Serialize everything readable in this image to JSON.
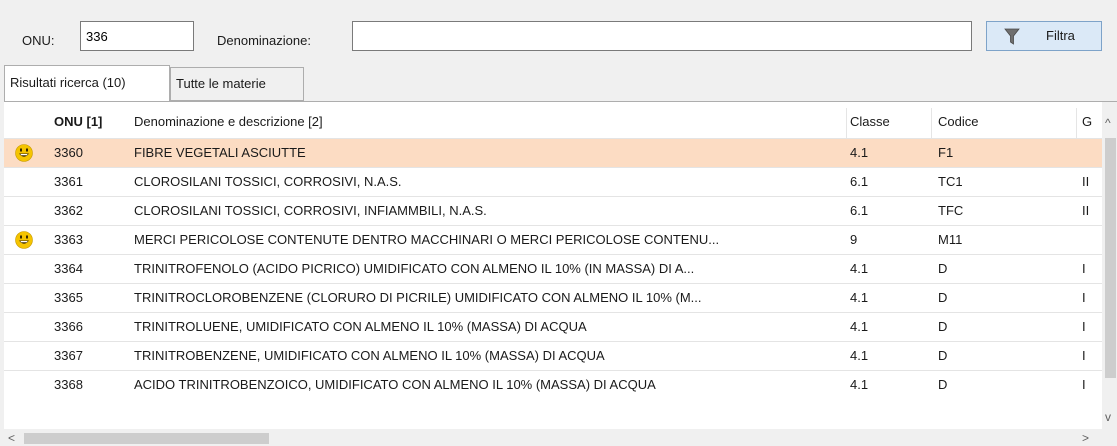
{
  "search": {
    "onu_label": "ONU:",
    "onu_value": "336",
    "denominazione_label": "Denominazione:",
    "denominazione_value": "",
    "filter_label": "Filtra"
  },
  "tabs": [
    {
      "label": "Risultati ricerca (10)",
      "active": true
    },
    {
      "label": "Tutte le materie",
      "active": false
    }
  ],
  "table": {
    "headers": {
      "onu": "ONU [1]",
      "denominazione": "Denominazione e descrizione [2]",
      "classe": "Classe",
      "codice": "Codice",
      "g": "G"
    },
    "rows": [
      {
        "icon": "smiley-icon",
        "onu": "3360",
        "desc": "FIBRE VEGETALI ASCIUTTE",
        "classe": "4.1",
        "codice": "F1",
        "g": "",
        "selected": true
      },
      {
        "icon": "",
        "onu": "3361",
        "desc": "CLOROSILANI TOSSICI, CORROSIVI, N.A.S.",
        "classe": "6.1",
        "codice": "TC1",
        "g": "II",
        "selected": false
      },
      {
        "icon": "",
        "onu": "3362",
        "desc": "CLOROSILANI TOSSICI, CORROSIVI, INFIAMMBILI, N.A.S.",
        "classe": "6.1",
        "codice": "TFC",
        "g": "II",
        "selected": false
      },
      {
        "icon": "smiley-icon",
        "onu": "3363",
        "desc": "MERCI PERICOLOSE CONTENUTE DENTRO MACCHINARI O MERCI PERICOLOSE CONTENU...",
        "classe": "9",
        "codice": "M11",
        "g": "",
        "selected": false
      },
      {
        "icon": "",
        "onu": "3364",
        "desc": "TRINITROFENOLO (ACIDO PICRICO) UMIDIFICATO CON ALMENO IL 10% (IN MASSA) DI A...",
        "classe": "4.1",
        "codice": "D",
        "g": "I",
        "selected": false
      },
      {
        "icon": "",
        "onu": "3365",
        "desc": "TRINITROCLOROBENZENE (CLORURO DI PICRILE) UMIDIFICATO CON ALMENO IL 10% (M...",
        "classe": "4.1",
        "codice": "D",
        "g": "I",
        "selected": false
      },
      {
        "icon": "",
        "onu": "3366",
        "desc": "TRINITROLUENE, UMIDIFICATO CON ALMENO IL 10% (MASSA) DI ACQUA",
        "classe": "4.1",
        "codice": "D",
        "g": "I",
        "selected": false
      },
      {
        "icon": "",
        "onu": "3367",
        "desc": "TRINITROBENZENE, UMIDIFICATO CON ALMENO IL 10% (MASSA) DI ACQUA",
        "classe": "4.1",
        "codice": "D",
        "g": "I",
        "selected": false
      },
      {
        "icon": "",
        "onu": "3368",
        "desc": "ACIDO TRINITROBENZOICO, UMIDIFICATO CON ALMENO IL 10% (MASSA) DI ACQUA",
        "classe": "4.1",
        "codice": "D",
        "g": "I",
        "selected": false
      }
    ]
  },
  "scrollbars": {
    "up": "^",
    "down": "v",
    "left": "<",
    "right": ">"
  },
  "colors": {
    "selected_row": "#fcdcc3",
    "filter_button": "#dbe9f7",
    "smiley": "#f5c400"
  }
}
